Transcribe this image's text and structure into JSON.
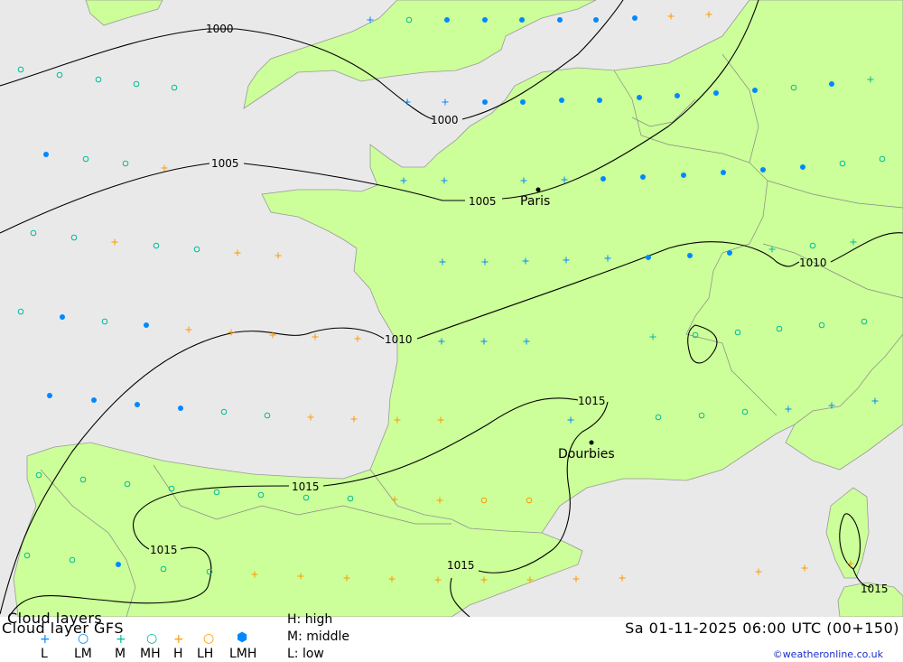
{
  "header": {
    "title": "Cloud layers",
    "subtitle": "Cloud layer  GFS",
    "legend_keys": [
      "L",
      "LM",
      "M",
      "MH",
      "H",
      "LH",
      "LMH"
    ],
    "high": "H: high",
    "middle": "M: middle",
    "low": "L: low",
    "datetime": "Sa 01-11-2025 06:00 UTC (00+150)",
    "credit": "©weatheronline.co.uk"
  },
  "map": {
    "cities": [
      "Paris",
      "Dourbies"
    ],
    "isobar_labels": [
      "1000",
      "1000",
      "1005",
      "1005",
      "1010",
      "1010",
      "1015",
      "1015",
      "1015",
      "1015",
      "1015"
    ]
  },
  "colors": {
    "sea": "#e9e9e9",
    "land": "#ccff99",
    "low_cloud": "#0088ff",
    "middle_cloud": "#00bb99",
    "high_cloud": "#ff9900",
    "isobar": "#000000"
  }
}
